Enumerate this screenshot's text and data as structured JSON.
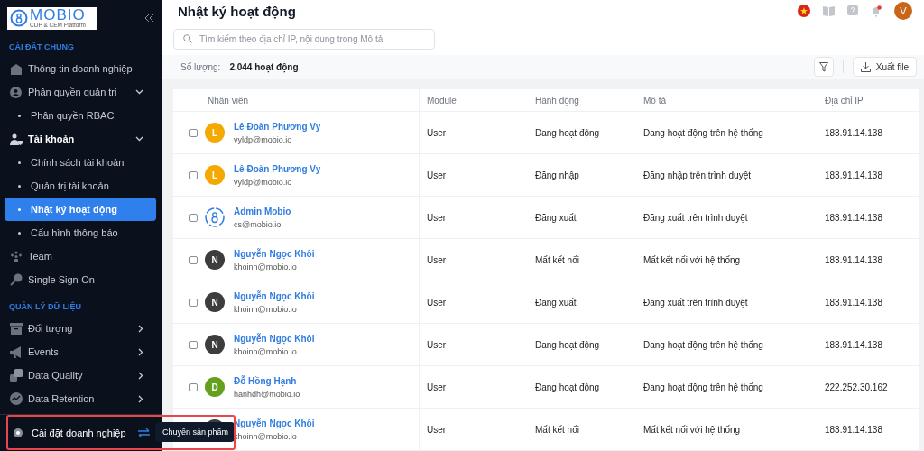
{
  "sidebar": {
    "logo": {
      "name": "MOBIO",
      "tagline": "CDP & CEM Platform"
    },
    "sections": [
      {
        "title": "CÀI ĐẶT CHUNG",
        "items": [
          {
            "label": "Thông tin doanh nghiệp",
            "selected": false
          },
          {
            "label": "Phân quyền quản trị",
            "selected": false,
            "expanded": true,
            "children": [
              {
                "label": "Phân quyền RBAC",
                "selected": false
              }
            ]
          },
          {
            "label": "Tài khoản",
            "selected": false,
            "expanded": true,
            "children": [
              {
                "label": "Chính sách tài khoản",
                "selected": false
              },
              {
                "label": "Quản trị tài khoản",
                "selected": false
              },
              {
                "label": "Nhật ký hoạt động",
                "selected": true
              },
              {
                "label": "Cấu hình thông báo",
                "selected": false
              }
            ]
          },
          {
            "label": "Team",
            "selected": false
          },
          {
            "label": "Single Sign-On",
            "selected": false
          }
        ]
      },
      {
        "title": "QUẢN LÝ DỮ LIỆU",
        "items": [
          {
            "label": "Đối tượng",
            "selected": false,
            "expanded": false
          },
          {
            "label": "Events",
            "selected": false,
            "expanded": false
          },
          {
            "label": "Data Quality",
            "selected": false,
            "expanded": false
          },
          {
            "label": "Data Retention",
            "selected": false,
            "expanded": false
          }
        ]
      }
    ],
    "footer": {
      "label": "Cài đặt doanh nghiệp"
    },
    "tooltip": {
      "text": "Chuyển sản phẩm"
    }
  },
  "header": {
    "title": "Nhật ký hoạt động",
    "notification_dot": true,
    "avatar": "V"
  },
  "toolbar": {
    "search": {
      "placeholder": "Tìm kiếm theo địa chỉ IP, nội dung trong Mô tả"
    },
    "count_label": "Số lượng:",
    "count": "2.044 hoạt động",
    "export": "Xuất file"
  },
  "table": {
    "columns": [
      "Nhân viên",
      "Module",
      "Hành động",
      "Mô tả",
      "Địa chỉ IP"
    ],
    "rows": [
      {
        "checked": false,
        "avatar": {
          "kind": "letter",
          "letter": "L",
          "color": "#f5a900"
        },
        "name": "Lê Đoàn Phương Vy",
        "email": "vyldp@mobio.io",
        "module": "User",
        "action": "Đang hoạt động",
        "description": "Đang hoạt động trên hệ thống",
        "ip": "183.91.14.138"
      },
      {
        "checked": false,
        "avatar": {
          "kind": "letter",
          "letter": "L",
          "color": "#f5a900"
        },
        "name": "Lê Đoàn Phương Vy",
        "email": "vyldp@mobio.io",
        "module": "User",
        "action": "Đăng nhập",
        "description": "Đăng nhập trên trình duyệt",
        "ip": "183.91.14.138"
      },
      {
        "checked": false,
        "avatar": {
          "kind": "logo"
        },
        "name": "Admin Mobio",
        "email": "cs@mobio.io",
        "module": "User",
        "action": "Đăng xuất",
        "description": "Đăng xuất trên trình duyệt",
        "ip": "183.91.14.138"
      },
      {
        "checked": false,
        "avatar": {
          "kind": "letter",
          "letter": "N",
          "color": "#3d3d3d"
        },
        "name": "Nguyễn Ngọc Khôi",
        "email": "khoinn@mobio.io",
        "module": "User",
        "action": "Mất kết nối",
        "description": "Mất kết nối với hệ thống",
        "ip": "183.91.14.138"
      },
      {
        "checked": false,
        "avatar": {
          "kind": "letter",
          "letter": "N",
          "color": "#3d3d3d"
        },
        "name": "Nguyễn Ngọc Khôi",
        "email": "khoinn@mobio.io",
        "module": "User",
        "action": "Đăng xuất",
        "description": "Đăng xuất trên trình duyệt",
        "ip": "183.91.14.138"
      },
      {
        "checked": false,
        "avatar": {
          "kind": "letter",
          "letter": "N",
          "color": "#3d3d3d"
        },
        "name": "Nguyễn Ngọc Khôi",
        "email": "khoinn@mobio.io",
        "module": "User",
        "action": "Đang hoạt động",
        "description": "Đang hoạt động trên hệ thống",
        "ip": "183.91.14.138"
      },
      {
        "checked": false,
        "avatar": {
          "kind": "letter",
          "letter": "D",
          "color": "#63a01e"
        },
        "name": "Đỗ Hồng Hạnh",
        "email": "hanhdh@mobio.io",
        "module": "User",
        "action": "Đang hoạt động",
        "description": "Đang hoạt động trên hệ thống",
        "ip": "222.252.30.162"
      },
      {
        "avatar": {
          "kind": "covered",
          "color": "#3d3d3d"
        },
        "name": "Nguyễn Ngọc Khôi",
        "email": "khoinn@mobio.io",
        "module": "User",
        "action": "Mất kết nối",
        "description": "Mất kết nối với hệ thống",
        "ip": "183.91.14.138"
      }
    ]
  }
}
